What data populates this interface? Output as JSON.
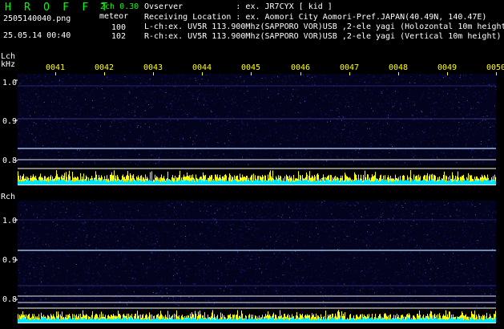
{
  "header": {
    "logo": "H R O F F T",
    "version": "2ch 0.30",
    "meteor_label": "meteor",
    "filename": "2505140040.png",
    "timestamp": "25.05.14 00:40",
    "lch_count": "100",
    "rch_count": "102",
    "observer": "Ovserver           : ex. JR7CYX [ kid ]",
    "location": "Receiving Location : ex. Aomori City Aomori-Pref.JAPAN(40.49N, 140.47E)",
    "lch_info": "L-ch:ex. UV5R 113.900Mhz(SAPPORO VOR)USB ,2-ele yagi (Holozontal 10m height)",
    "rch_info": "R-ch:ex. UV5R 113.900Mhz(SAPPORO VOR)USB ,2-ele yagi (Vertical 10m height)"
  },
  "lch": {
    "label": "Lch",
    "unit": "kHz",
    "yticks": [
      "1.0",
      "0.9",
      "0.8"
    ]
  },
  "rch": {
    "label": "Rch",
    "yticks": [
      "1.0",
      "0.9",
      "0.8"
    ]
  },
  "time_ticks": [
    "0041",
    "0042",
    "0043",
    "0044",
    "0045",
    "0046",
    "0047",
    "0048",
    "0049",
    "0050"
  ],
  "colors": {
    "logo": "#00ff00",
    "tick": "#ffff00",
    "bar": "#ffff00",
    "bar_base": "#00e5ff",
    "background": "#000000",
    "noise": "#101050",
    "trace": "#b0d8ff"
  }
}
